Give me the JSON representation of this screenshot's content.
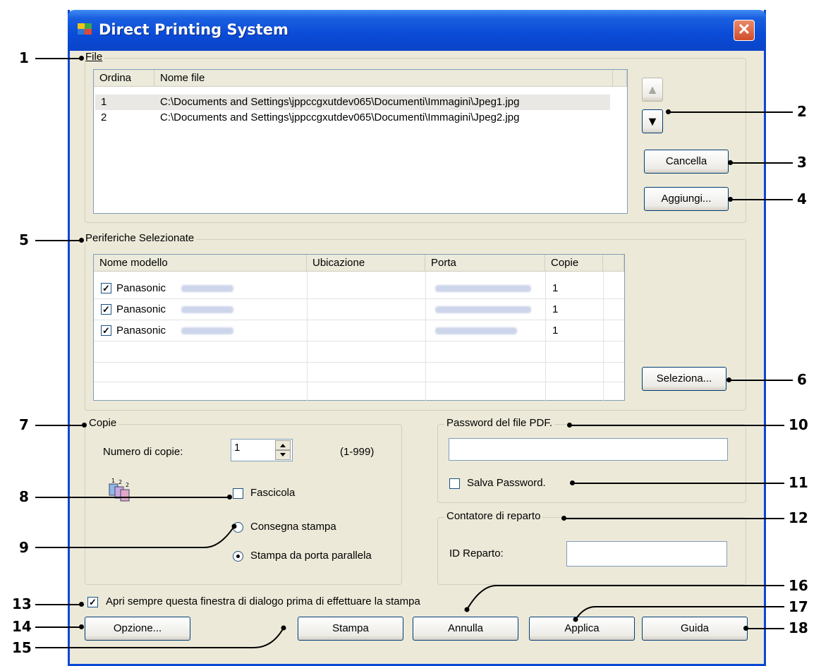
{
  "window": {
    "title": "Direct Printing System",
    "close_glyph": "✕"
  },
  "file_group": {
    "label": "File",
    "columns": [
      "Ordina",
      "Nome file"
    ],
    "rows": [
      {
        "order": "1",
        "path": "C:\\Documents and Settings\\jppccgxutdev065\\Documenti\\Immagini\\Jpeg1.jpg"
      },
      {
        "order": "2",
        "path": "C:\\Documents and Settings\\jppccgxutdev065\\Documenti\\Immagini\\Jpeg2.jpg"
      }
    ],
    "up_glyph": "▲",
    "down_glyph": "▼",
    "cancella_label": "Cancella",
    "aggiungi_label": "Aggiungi..."
  },
  "devices_group": {
    "label": "Periferiche Selezionate",
    "columns": [
      "Nome modello",
      "Ubicazione",
      "Porta",
      "Copie"
    ],
    "rows": [
      {
        "model": "Panasonic",
        "copies": "1"
      },
      {
        "model": "Panasonic",
        "copies": "1"
      },
      {
        "model": "Panasonic",
        "copies": "1"
      }
    ],
    "check_glyph": "✓",
    "seleziona_label": "Seleziona..."
  },
  "copies_group": {
    "label": "Copie",
    "num_label": "Numero di copie:",
    "num_value": "1",
    "range": "(1-999)",
    "collate_label": "Fascicola",
    "radio1_label": "Consegna stampa",
    "radio2_label": "Stampa da porta parallela"
  },
  "pdf_group": {
    "label": "Password del file PDF.",
    "save_label": "Salva Password."
  },
  "dept_group": {
    "label": "Contatore di reparto",
    "id_label": "ID Reparto:"
  },
  "always_open_label": "Apri sempre questa finestra di dialogo prima di effettuare la stampa",
  "buttons": {
    "opzione": "Opzione...",
    "stampa": "Stampa",
    "annulla": "Annulla",
    "applica": "Applica",
    "guida": "Guida"
  },
  "callouts": [
    "1",
    "2",
    "3",
    "4",
    "5",
    "6",
    "7",
    "8",
    "9",
    "10",
    "11",
    "12",
    "13",
    "14",
    "15",
    "16",
    "17",
    "18"
  ],
  "colors": {
    "titlebar": "#0a4bd7",
    "dialog_bg": "#ece9d8",
    "close": "#d14d2b"
  }
}
